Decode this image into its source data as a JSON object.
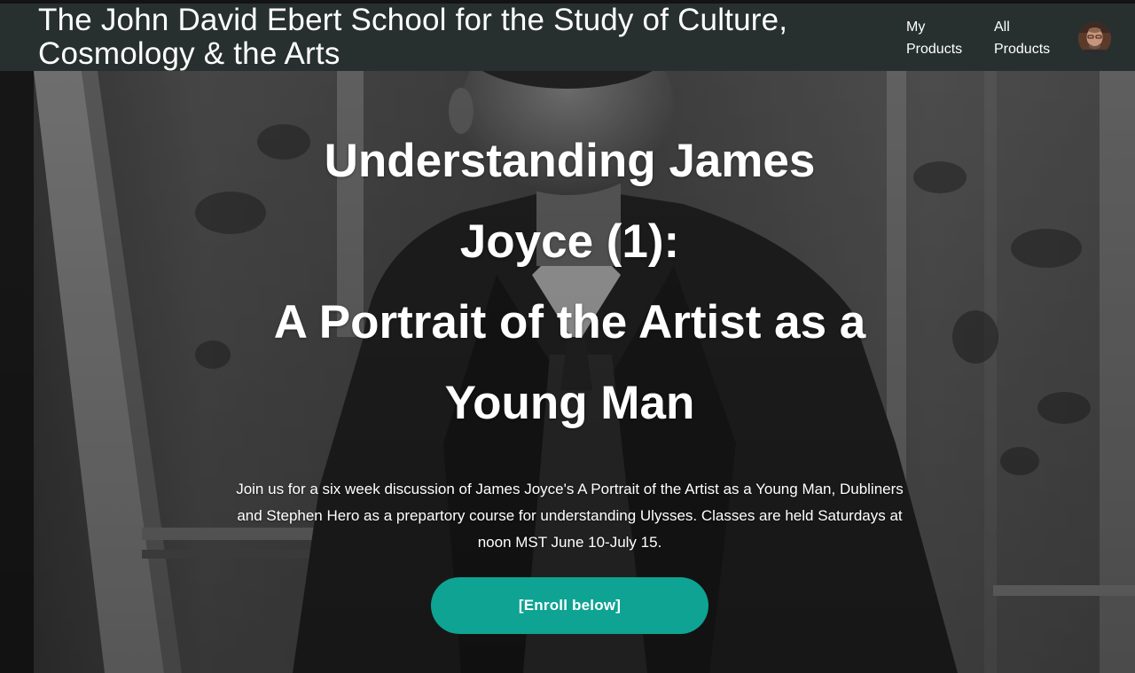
{
  "header": {
    "site_title": "The John David Ebert School for the Study of Culture, Cosmology & the Arts",
    "nav": [
      {
        "label": "My Products"
      },
      {
        "label": "All Products"
      }
    ]
  },
  "hero": {
    "title_lines": [
      "Understanding James",
      "Joyce (1):",
      "A Portrait of the Artist as a",
      "Young Man"
    ],
    "description": "Join us for a six week discussion of James Joyce's A Portrait of the Artist as a Young Man, Dubliners and Stephen Hero as a prepartory course for understanding Ulysses. Classes are held Saturdays at noon MST June 10-July 15.",
    "cta_label": "[Enroll below]"
  },
  "colors": {
    "header_bg": "#27302f",
    "cta_bg": "#0ea393",
    "text": "#ffffff"
  },
  "icons": {
    "avatar": "user-avatar-photo"
  }
}
